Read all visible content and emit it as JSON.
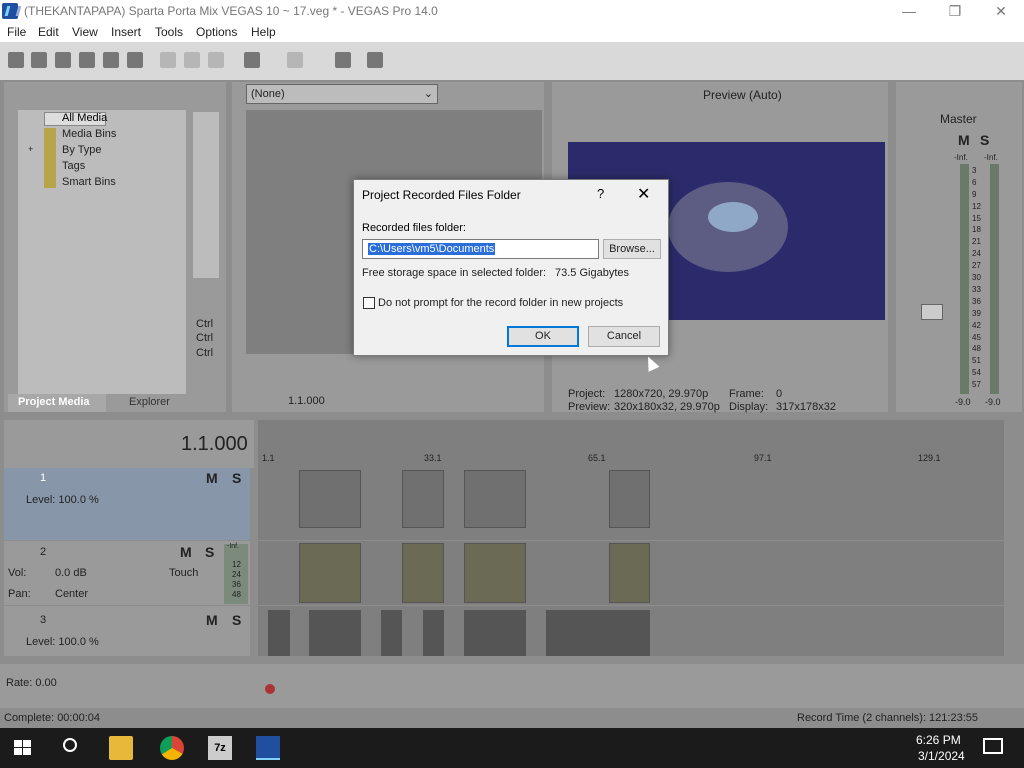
{
  "window": {
    "title": "(THEKANTAPAPA) Sparta Porta Mix VEGAS 10 ~ 17.veg * - VEGAS Pro 14.0",
    "minimize": "—",
    "maximize": "❐",
    "close": "✕"
  },
  "menu": [
    "File",
    "Edit",
    "View",
    "Insert",
    "Tools",
    "Options",
    "Help"
  ],
  "media_tree": {
    "items": [
      "All Media",
      "Media Bins",
      "By Type",
      "Tags",
      "Smart Bins"
    ],
    "expander": "+"
  },
  "ctrl_labels": [
    "Ctrl",
    "Ctrl",
    "Ctrl"
  ],
  "tabs": {
    "project_media": "Project Media",
    "explorer": "Explorer"
  },
  "trimmer": {
    "dropdown": "(None)",
    "time": "1.1.000"
  },
  "preview": {
    "quality": "Preview (Auto)",
    "project_label": "Project:",
    "project_value": "1280x720, 29.970p",
    "frame_label": "Frame:",
    "frame_value": "0",
    "preview_label": "Preview:",
    "preview_value": "320x180x32, 29.970p",
    "display_label": "Display:",
    "display_value": "317x178x32"
  },
  "master": {
    "label": "Master",
    "m": "M",
    "s": "S",
    "inf_left": "-Inf.",
    "inf_right": "-Inf.",
    "scale": [
      "3",
      "6",
      "9",
      "12",
      "15",
      "18",
      "21",
      "24",
      "27",
      "30",
      "33",
      "36",
      "39",
      "42",
      "45",
      "48",
      "51",
      "54",
      "57"
    ],
    "bottom_left": "-9.0",
    "bottom_right": "-9.0"
  },
  "timeline": {
    "cursor_time": "1.1.000",
    "ruler": [
      "1.1",
      "33.1",
      "65.1",
      "97.1",
      "129.1"
    ],
    "rate": "Rate: 0.00"
  },
  "tracks": [
    {
      "num": "1",
      "level_label": "Level: 100.0 %",
      "m": "M",
      "s": "S"
    },
    {
      "num": "2",
      "vol_label": "Vol:",
      "vol_value": "0.0 dB",
      "pan_label": "Pan:",
      "pan_value": "Center",
      "touch": "Touch",
      "m": "M",
      "s": "S",
      "meter": [
        "-Inf.",
        "12",
        "24",
        "36",
        "48"
      ]
    },
    {
      "num": "3",
      "level_label": "Level: 100.0 %",
      "m": "M",
      "s": "S"
    }
  ],
  "dialog": {
    "title": "Project Recorded Files Folder",
    "help": "?",
    "close": "✕",
    "folder_label": "Recorded files folder:",
    "folder_value": "C:\\Users\\vm5\\Documents",
    "browse": "Browse...",
    "space_label": "Free storage space in selected folder:",
    "space_value": "73.5 Gigabytes",
    "checkbox_label": "Do not prompt for the record folder in new projects",
    "ok": "OK",
    "cancel": "Cancel"
  },
  "status": {
    "complete": "Complete: 00:00:04",
    "record_time": "Record Time (2 channels): 121:23:55"
  },
  "taskbar": {
    "time": "6:26 PM",
    "date": "3/1/2024",
    "apps": [
      "start-icon",
      "search-icon",
      "file-explorer-icon",
      "chrome-icon",
      "7zip-icon",
      "vegas-icon"
    ]
  },
  "colors": {
    "accent": "#0078d7",
    "selection": "#2a6edb"
  }
}
